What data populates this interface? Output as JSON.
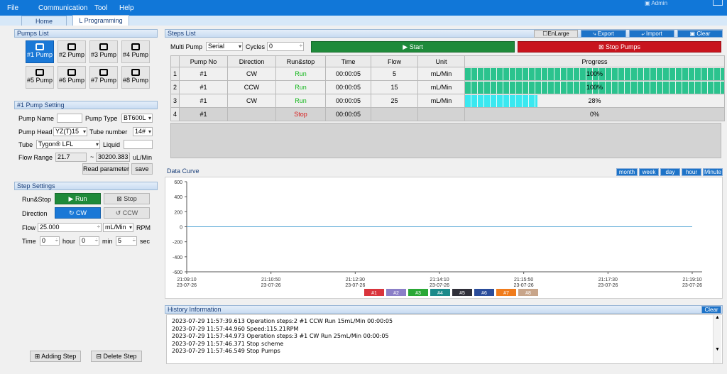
{
  "menu": [
    "File",
    "Communication",
    "Tool",
    "Help"
  ],
  "user_label": "Admin",
  "tabs": [
    "Home",
    "L Programming"
  ],
  "pumps_list": {
    "title": "Pumps List",
    "pumps": [
      "#1 Pump",
      "#2 Pump",
      "#3 Pump",
      "#4 Pump",
      "#5 Pump",
      "#6 Pump",
      "#7 Pump",
      "#8 Pump"
    ],
    "selected": 0
  },
  "pump_setting": {
    "title": "#1 Pump Setting",
    "pump_name_label": "Pump Name",
    "pump_name": "",
    "pump_type_label": "Pump Type",
    "pump_type": "BT600L",
    "pump_head_label": "Pump Head",
    "pump_head": "YZ(T)15",
    "tube_number_label": "Tube number",
    "tube_number": "14#",
    "tube_label": "Tube",
    "tube": "Tygon® LFL",
    "liquid_label": "Liquid",
    "liquid": "",
    "flow_range_label": "Flow Range",
    "flow_min": "21.7",
    "flow_sep": "~",
    "flow_max": "30200.383",
    "flow_unit": "uL/Min",
    "read_params": "Read parameter",
    "save": "save"
  },
  "step_settings": {
    "title": "Step Settings",
    "runstop_label": "Run&Stop",
    "run": "Run",
    "stop": "Stop",
    "direction_label": "Direction",
    "cw": "CW",
    "ccw": "CCW",
    "flow_label": "Flow",
    "flow_value": "25.000",
    "flow_unit": "mL/Min",
    "rpm": "RPM",
    "time_label": "Time",
    "hour_value": "0",
    "hour_label": "hour",
    "min_value": "0",
    "min_label": "min",
    "sec_value": "5",
    "sec_label": "sec",
    "add_step": "Adding Step",
    "delete_step": "Delete Step"
  },
  "steps_list": {
    "title": "Steps List",
    "enlarge": "EnLarge",
    "export": "Export",
    "import": "Import",
    "clear": "Clear",
    "multi_pump_label": "Multi Pump",
    "mode": "Serial",
    "cycles_label": "Cycles",
    "cycles": "0",
    "start": "Start",
    "stop_pumps": "Stop Pumps",
    "columns": [
      "Pump No",
      "Direction",
      "Run&stop",
      "Time",
      "Flow",
      "Unit",
      "Progress"
    ],
    "rows": [
      {
        "idx": "1",
        "pump": "#1",
        "direction": "CW",
        "run": "Run",
        "time": "00:00:05",
        "flow": "5",
        "unit": "mL/Min",
        "progress": "100%",
        "pct": 100
      },
      {
        "idx": "2",
        "pump": "#1",
        "direction": "CCW",
        "run": "Run",
        "time": "00:00:05",
        "flow": "15",
        "unit": "mL/Min",
        "progress": "100%",
        "pct": 100
      },
      {
        "idx": "3",
        "pump": "#1",
        "direction": "CW",
        "run": "Run",
        "time": "00:00:05",
        "flow": "25",
        "unit": "mL/Min",
        "progress": "28%",
        "pct": 28
      },
      {
        "idx": "4",
        "pump": "#1",
        "direction": "",
        "run": "Stop",
        "time": "00:00:05",
        "flow": "",
        "unit": "",
        "progress": "0%",
        "pct": 0
      }
    ]
  },
  "data_curve": {
    "title": "Data Curve",
    "ranges": [
      "month",
      "week",
      "day",
      "hour",
      "Minute"
    ],
    "legend": [
      "#1",
      "#2",
      "#3",
      "#4",
      "#5",
      "#6",
      "#7",
      "#8"
    ],
    "legend_colors": [
      "#d9343c",
      "#8b7fc7",
      "#2aa836",
      "#1c8a8a",
      "#30303a",
      "#2a4c9a",
      "#f07c1c",
      "#c8a58a"
    ]
  },
  "chart_data": {
    "type": "line",
    "y_ticks": [
      600,
      400,
      200,
      0,
      -200,
      -400,
      -600
    ],
    "ylim": [
      -600,
      600
    ],
    "x_ticks": [
      {
        "time": "21:09:10",
        "date": "23-07-26"
      },
      {
        "time": "21:10:50",
        "date": "23-07-26"
      },
      {
        "time": "21:12:30",
        "date": "23-07-26"
      },
      {
        "time": "21:14:10",
        "date": "23-07-26"
      },
      {
        "time": "21:15:50",
        "date": "23-07-26"
      },
      {
        "time": "21:17:30",
        "date": "23-07-26"
      },
      {
        "time": "21:19:10",
        "date": "23-07-26"
      }
    ],
    "series": [
      {
        "color": "#5aa9d6",
        "x": [
          "21:09:10",
          "21:19:10"
        ],
        "y": [
          0,
          0
        ]
      }
    ]
  },
  "history": {
    "title": "History Information",
    "clear": "Clear",
    "lines": [
      "2023-07-29 11:57:39.613 Operation steps:2 #1 CCW Run 15mL/Min 00:00:05",
      "2023-07-29 11:57:44.960 Speed:115.21RPM",
      "2023-07-29 11:57:44.973 Operation steps:3 #1 CW Run 25mL/Min 00:00:05",
      "2023-07-29 11:57:46.371 Stop scheme",
      "2023-07-29 11:57:46.549 Stop Pumps"
    ]
  }
}
